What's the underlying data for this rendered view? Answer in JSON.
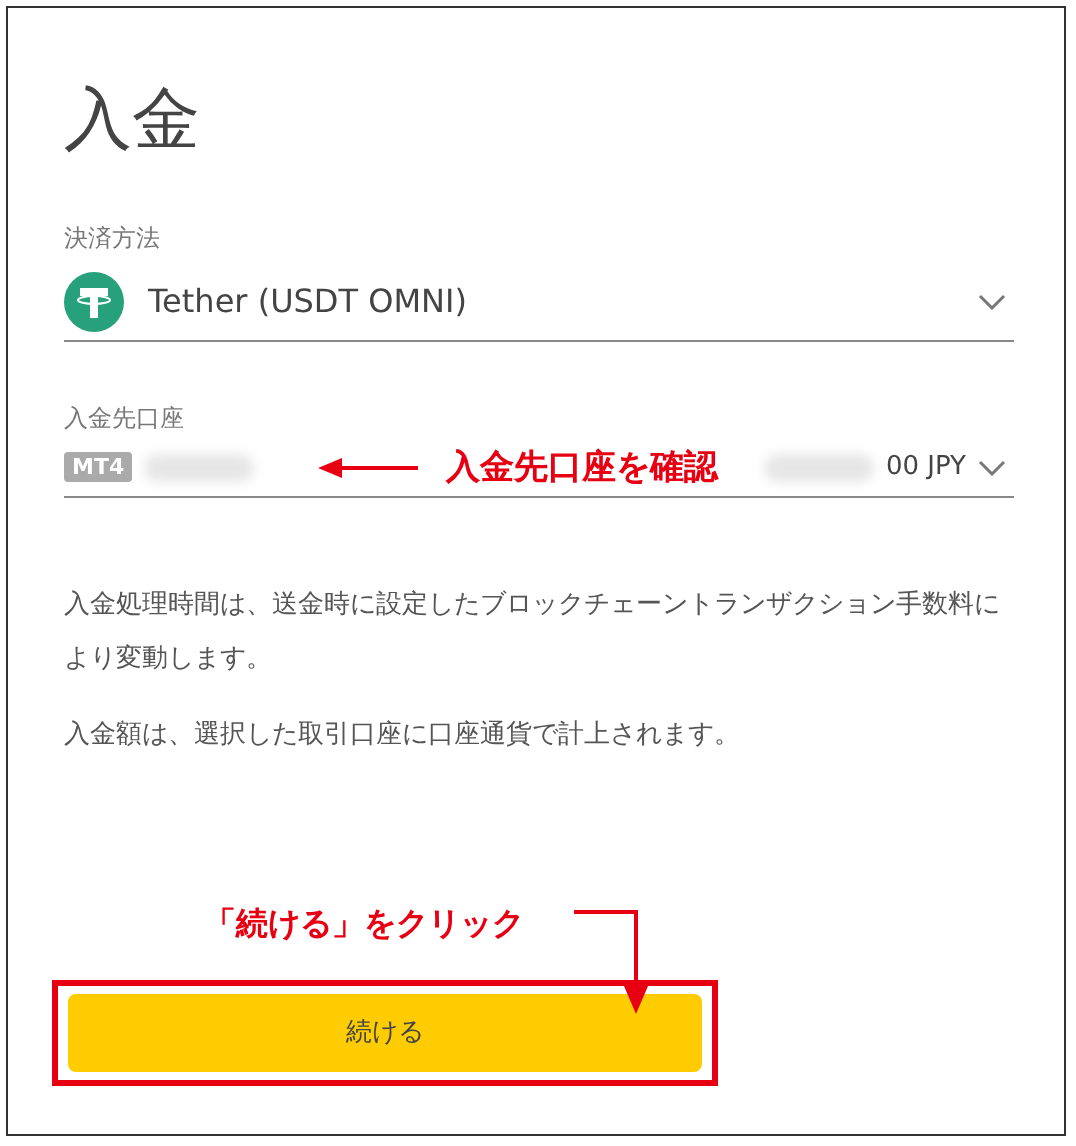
{
  "title": "入金",
  "payment_method": {
    "label": "決済方法",
    "value": "Tether (USDT OMNI)"
  },
  "account": {
    "label": "入金先口座",
    "platform": "MT4",
    "balance": "00 JPY"
  },
  "account_annotation": "入金先口座を確認",
  "notes": [
    "入金処理時間は、送金時に設定したブロックチェーントランザクション手数料により変動します。",
    "入金額は、選択した取引口座に口座通貨で計上されます。"
  ],
  "button_annotation": "「続ける」をクリック",
  "continue_button": "続ける"
}
